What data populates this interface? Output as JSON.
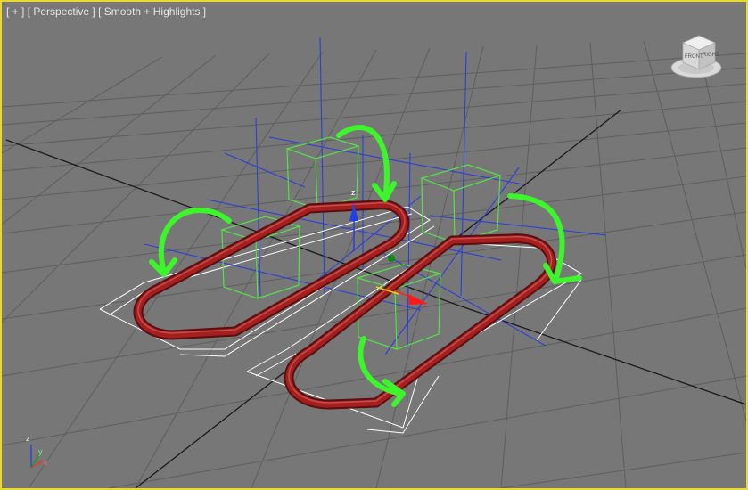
{
  "viewport": {
    "menu_label": "[ + ]",
    "view_label": "[ Perspective ]",
    "shading_label": "[ Smooth + Highlights ]",
    "active_border_color": "#e8d930",
    "background_color": "#777777"
  },
  "viewcube": {
    "front_label": "FRONT",
    "right_label": "RIGHT"
  },
  "gizmo": {
    "z_label": "z"
  },
  "axis_tripod": {
    "z_label": "z",
    "x_label": "x",
    "y_label": "y"
  },
  "colors": {
    "grid": "#5e5e5e",
    "grid_center": "#1a1a1a",
    "tube": "#9a1d1d",
    "box_wire": "#56e04a",
    "arrow": "#3cf52a",
    "helper_blue": "#2c3fd8"
  },
  "icons": [
    "viewcube-icon",
    "axis-tripod-icon",
    "move-gizmo-icon",
    "curved-arrow-icon"
  ]
}
